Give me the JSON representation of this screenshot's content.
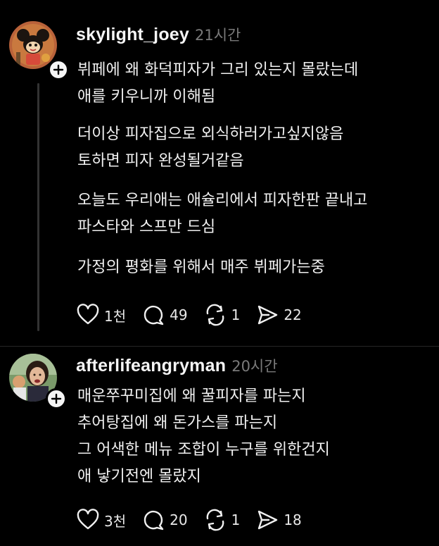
{
  "posts": [
    {
      "username": "skylight_joey",
      "time": "21시간",
      "paragraphs": [
        [
          "뷔페에 왜 화덕피자가 그리 있는지 몰랐는데",
          "애를 키우니까 이해됨"
        ],
        [
          "더이상 피자집으로 외식하러가고싶지않음",
          "토하면 피자 완성될거같음"
        ],
        [
          "오늘도 우리애는 애슐리에서 피자한판 끝내고",
          "파스타와 스프만 드심"
        ],
        [
          "가정의 평화를 위해서 매주 뷔페가는중"
        ]
      ],
      "likes": "1천",
      "comments": "49",
      "reposts": "1",
      "shares": "22"
    },
    {
      "username": "afterlifeangryman",
      "time": "20시간",
      "paragraphs": [
        [
          "매운쭈꾸미집에 왜 꿀피자를 파는지",
          "추어탕집에 왜 돈가스를 파는지",
          "그 어색한 메뉴 조합이 누구를 위한건지",
          "애 낳기전엔 몰랐지"
        ]
      ],
      "likes": "3천",
      "comments": "20",
      "reposts": "1",
      "shares": "18"
    }
  ],
  "icons": {
    "follow": "plus-icon",
    "like": "heart-icon",
    "comment": "comment-bubble-icon",
    "repost": "repost-icon",
    "share": "send-icon"
  },
  "colors": {
    "background": "#000000",
    "text": "#f3f3f3",
    "muted": "#7a7a7a",
    "thread_line": "#333333"
  }
}
